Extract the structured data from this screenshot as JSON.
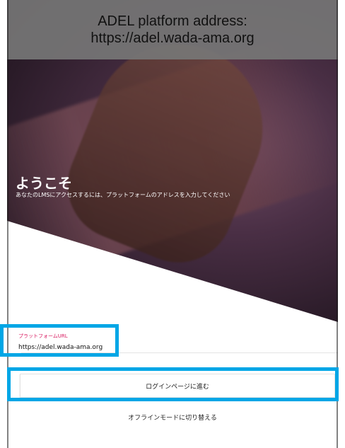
{
  "banner": {
    "line1": "ADEL platform address:",
    "line2": "https://adel.wada-ama.org"
  },
  "hero": {
    "welcome_title": "ようこそ",
    "subtitle": "あなたのLMSにアクセスするには、プラットフォームのアドレスを入力してください"
  },
  "form": {
    "url_label": "プラットフォームURL",
    "url_value": "https://adel.wada-ama.org"
  },
  "actions": {
    "proceed_login": "ログインページに進む",
    "offline_mode": "オフラインモードに切り替える"
  },
  "colors": {
    "highlight": "#00a6e6",
    "label_accent": "#d81b60",
    "banner_bg": "#767676"
  }
}
